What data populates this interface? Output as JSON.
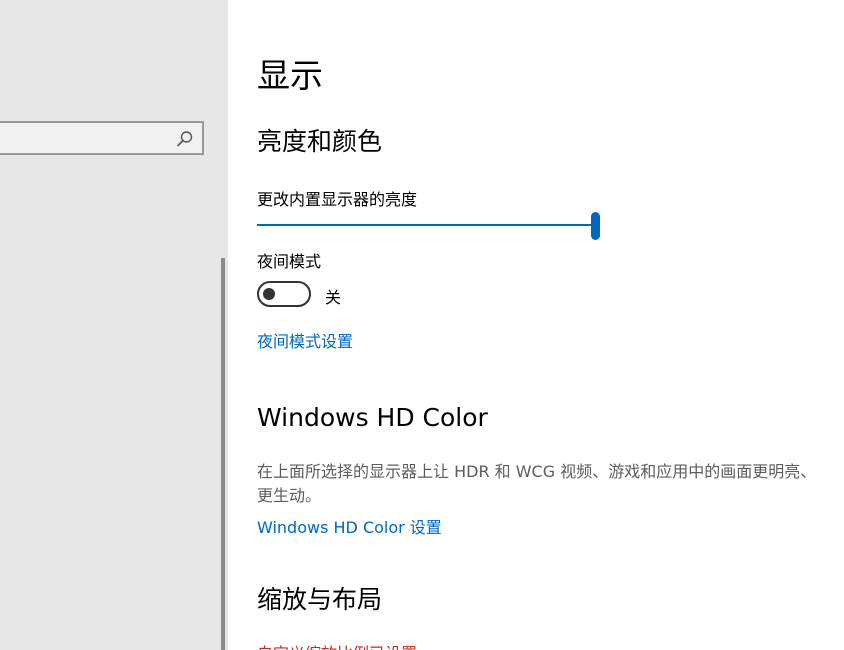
{
  "sidebar": {
    "search": {
      "value": "",
      "placeholder": ""
    }
  },
  "main": {
    "page_title": "显示",
    "brightness_section": {
      "title": "亮度和颜色",
      "brightness_label": "更改内置显示器的亮度",
      "brightness_value": 100,
      "night_light_label": "夜间模式",
      "night_light_state": "关",
      "night_light_settings_link": "夜间模式设置"
    },
    "hd_color_section": {
      "title": "Windows HD Color",
      "description": "在上面所选择的显示器上让 HDR 和 WCG 视频、游戏和应用中的画面更明亮、更生动。",
      "settings_link": "Windows HD Color 设置"
    },
    "scale_section": {
      "title": "缩放与布局",
      "custom_scaling_link": "自定义缩放比例已设置"
    }
  },
  "colors": {
    "accent": "#0067c0",
    "sidebar_bg": "#e6e6e6",
    "link_red": "#c42b1c"
  }
}
